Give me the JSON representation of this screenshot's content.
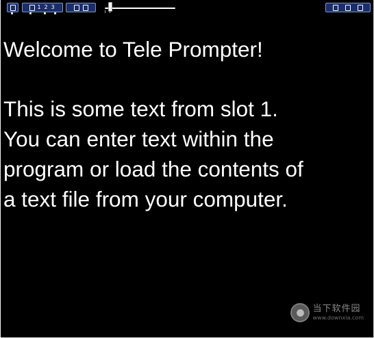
{
  "toolbar": {
    "left_buttons": [
      {
        "id": "slot-a",
        "label": ""
      },
      {
        "id": "slot-1",
        "label": "1"
      },
      {
        "id": "slot-2",
        "label": "2"
      },
      {
        "id": "slot-3",
        "label": "3"
      },
      {
        "id": "play",
        "label": ""
      },
      {
        "id": "stop",
        "label": ""
      }
    ],
    "right_buttons": [
      {
        "id": "right-1",
        "label": ""
      },
      {
        "id": "right-2",
        "label": ""
      },
      {
        "id": "right-3",
        "label": ""
      }
    ],
    "speed_slider": {
      "value_fraction": 0.05
    }
  },
  "prompter": {
    "heading": "Welcome to Tele Prompter!",
    "body_lines": [
      "This is some text from slot 1.",
      "You can enter text within the",
      "program or load the contents of",
      "a text file from your computer."
    ]
  },
  "watermark": {
    "title": "当下软件园",
    "url": "www.downxia.com"
  },
  "colors": {
    "background": "#000000",
    "text": "#ffffff",
    "button_fill": "#1c2e6a",
    "button_border": "#7f95cf"
  }
}
